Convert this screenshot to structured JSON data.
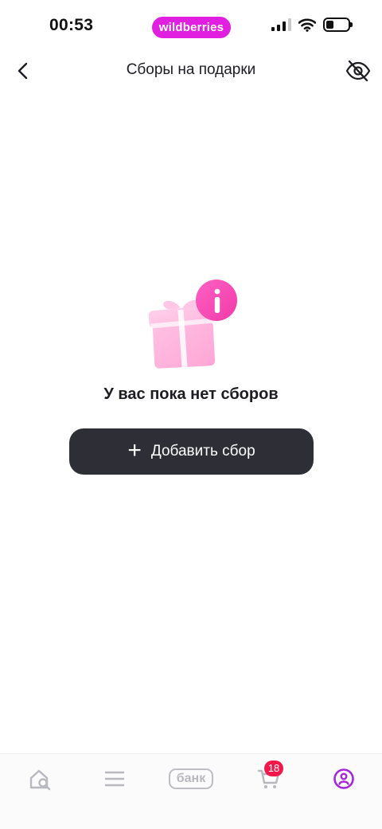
{
  "status_bar": {
    "time": "00:53",
    "brand": "wildberries",
    "icons": [
      "signal-icon",
      "wifi-icon",
      "battery-icon"
    ],
    "battery_level": 0.35
  },
  "header": {
    "title": "Сборы на подарки",
    "back_icon": "chevron-left-icon",
    "visibility_icon": "eye-off-icon"
  },
  "empty_state": {
    "illustration": "gift-info-icon",
    "message": "У вас пока нет сборов",
    "add_button_label": "Добавить сбор"
  },
  "bottom_nav": {
    "items": [
      {
        "icon": "home-search-icon"
      },
      {
        "icon": "menu-icon"
      },
      {
        "label": "банк"
      },
      {
        "icon": "cart-icon",
        "badge": "18"
      },
      {
        "icon": "profile-icon",
        "active": true
      }
    ]
  },
  "colors": {
    "brand": "#e11fe0",
    "button_bg": "#2e2e36",
    "nav_inactive": "#b8b8bf",
    "nav_active": "#a626d9",
    "badge": "#f0184a"
  }
}
